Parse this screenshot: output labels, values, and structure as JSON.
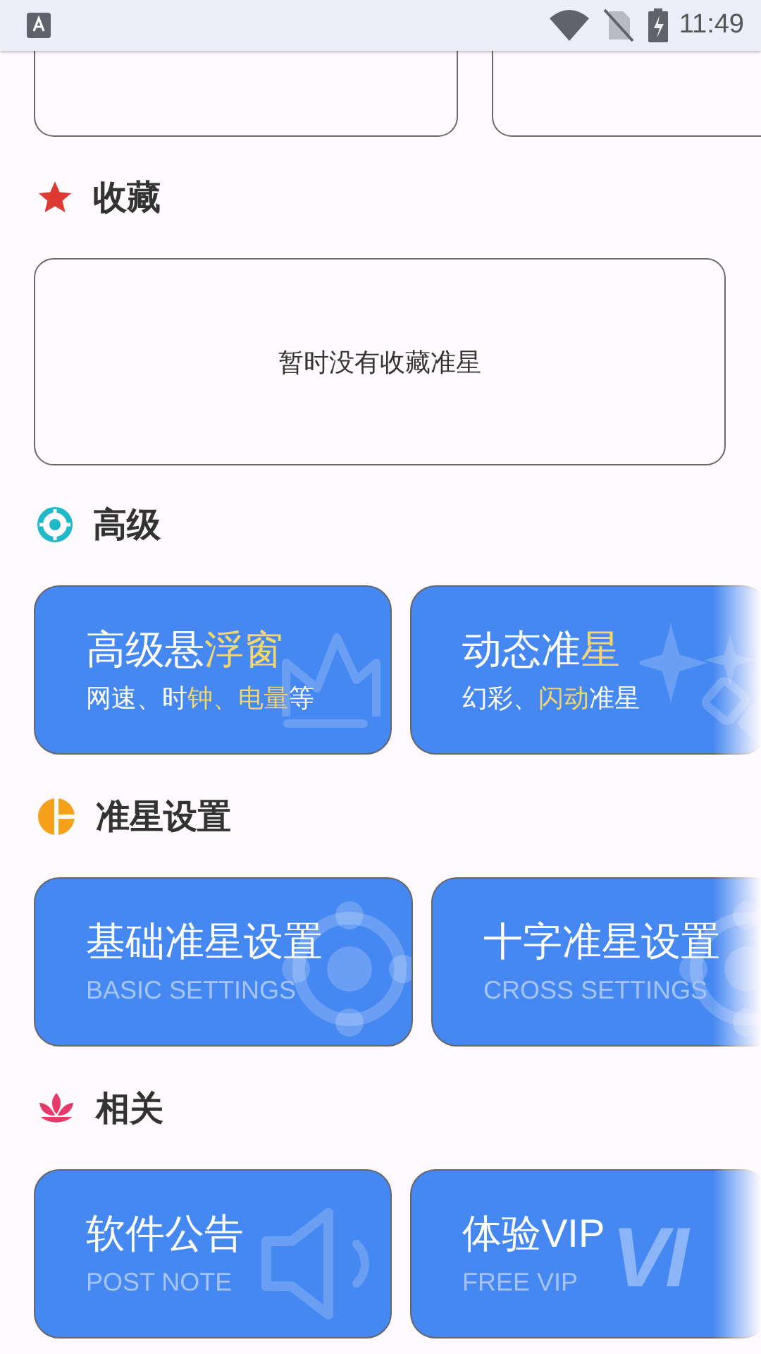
{
  "status_bar": {
    "time": "11:49"
  },
  "sections": [
    {
      "kind": "favorites",
      "title": "收藏",
      "empty_text": "暂时没有收藏准星"
    },
    {
      "kind": "advanced",
      "title": "高级",
      "cards": [
        {
          "kind": "crown",
          "subtitle_muted": false,
          "title": [
            {
              "text": "高级悬",
              "accent": false
            },
            {
              "text": "浮窗",
              "accent": true
            }
          ],
          "subtitle": [
            {
              "text": "网速、时",
              "accent": false
            },
            {
              "text": "钟、电量",
              "accent": true
            },
            {
              "text": "等",
              "accent": false
            }
          ]
        },
        {
          "kind": "sparkles",
          "subtitle_muted": false,
          "title": [
            {
              "text": "动态准",
              "accent": false
            },
            {
              "text": "星",
              "accent": true
            }
          ],
          "subtitle": [
            {
              "text": "幻彩、",
              "accent": false
            },
            {
              "text": "闪动",
              "accent": true
            },
            {
              "text": "准星",
              "accent": false
            }
          ]
        }
      ]
    },
    {
      "kind": "crosshair",
      "title": "准星设置",
      "cards": [
        {
          "kind": "target",
          "subtitle_muted": true,
          "title": [
            {
              "text": "基础准星设置",
              "accent": false
            }
          ],
          "subtitle": [
            {
              "text": "BASIC SETTINGS",
              "accent": false
            }
          ]
        },
        {
          "kind": "target",
          "subtitle_muted": true,
          "title": [
            {
              "text": "十字准星设置",
              "accent": false
            }
          ],
          "subtitle": [
            {
              "text": "CROSS SETTINGS",
              "accent": false
            }
          ]
        }
      ]
    },
    {
      "kind": "related",
      "title": "相关",
      "cards": [
        {
          "kind": "speaker",
          "subtitle_muted": true,
          "title": [
            {
              "text": "软件公告",
              "accent": false
            }
          ],
          "subtitle": [
            {
              "text": "POST NOTE",
              "accent": false
            }
          ]
        },
        {
          "kind": "word",
          "watermark": "VI",
          "subtitle_muted": true,
          "title": [
            {
              "text": "体验VIP",
              "accent": false
            }
          ],
          "subtitle": [
            {
              "text": "FREE VIP",
              "accent": false
            }
          ]
        }
      ]
    }
  ]
}
